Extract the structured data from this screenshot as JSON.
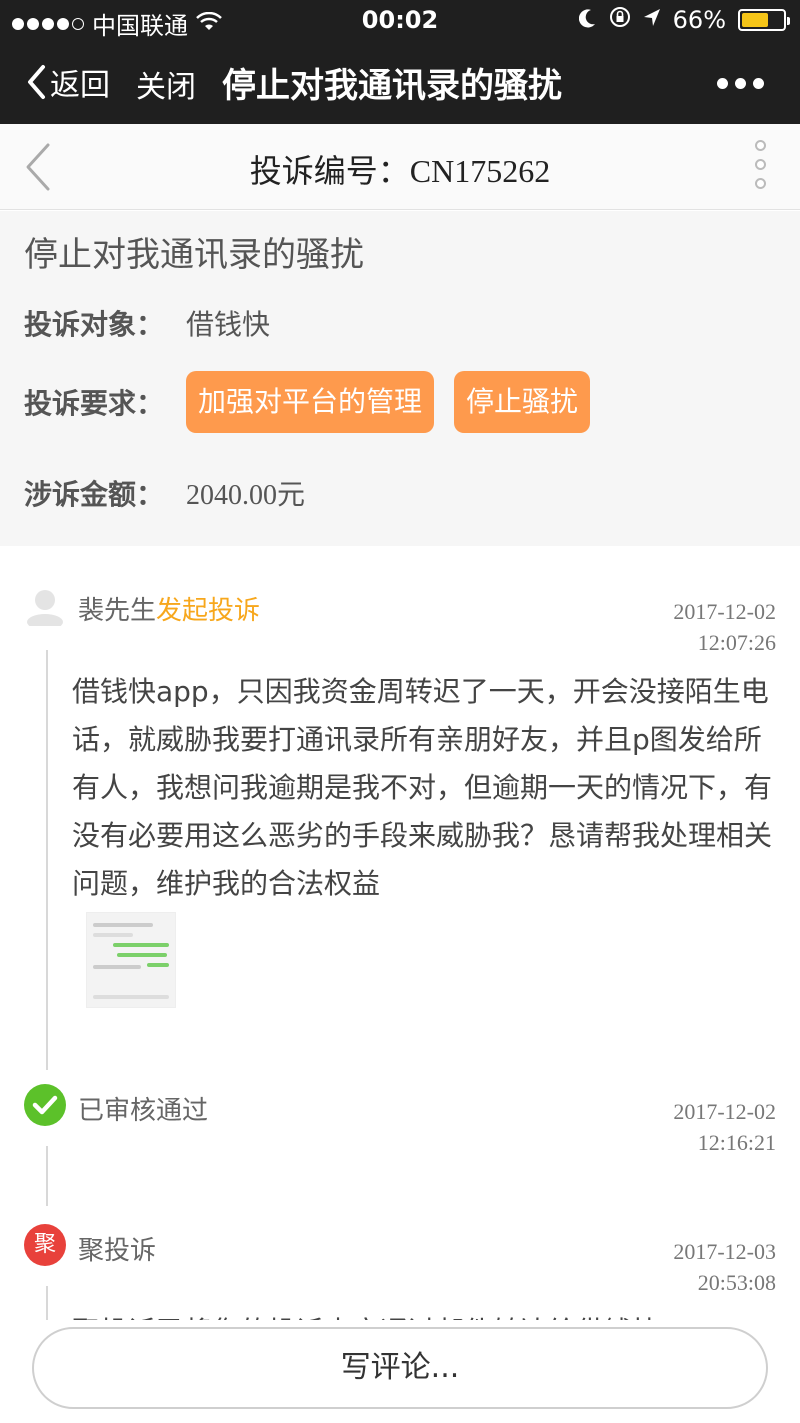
{
  "status_bar": {
    "carrier": "中国联通",
    "time": "00:02",
    "battery": "66%",
    "battery_level": 0.66
  },
  "navbar": {
    "back_label": "返回",
    "close_label": "关闭",
    "title": "停止对我通讯录的骚扰"
  },
  "subheader": {
    "title_prefix": "投诉编号：",
    "complaint_number": "CN175262"
  },
  "complaint": {
    "title": "停止对我通讯录的骚扰",
    "target_label": "投诉对象：",
    "target_value": "借钱快",
    "requests_label": "投诉要求：",
    "requests": [
      "加强对平台的管理",
      "停止骚扰"
    ],
    "amount_label": "涉诉金额：",
    "amount_value": "2040.00元"
  },
  "timeline": [
    {
      "user": "裴先生",
      "action": "发起投诉",
      "date": "2017-12-02",
      "time": "12:07:26",
      "icon": "user-avatar-icon",
      "content": "借钱快app，只因我资金周转迟了一天，开会没接陌生电话，就威胁我要打通讯录所有亲朋好友，并且p图发给所有人，我想问我逾期是我不对，但逾期一天的情况下，有没有必要用这么恶劣的手段来威胁我？恳请帮我处理相关问题，维护我的合法权益"
    },
    {
      "label": "已审核通过",
      "date": "2017-12-02",
      "time": "12:16:21",
      "icon": "check-circle-icon",
      "color": "#5cc12a"
    },
    {
      "label": "聚投诉",
      "date": "2017-12-03",
      "time": "20:53:08",
      "icon": "ju-logo-icon",
      "logo_char": "聚",
      "color": "#e8413b",
      "content": "聚投诉已将您的投诉内容通过邮件转达给借钱快"
    }
  ],
  "comment": {
    "button_label": "写评论..."
  },
  "colors": {
    "tag_orange": "#fe9a4d",
    "action_orange": "#f7a71c",
    "nav_dark": "#1f1f1f"
  }
}
